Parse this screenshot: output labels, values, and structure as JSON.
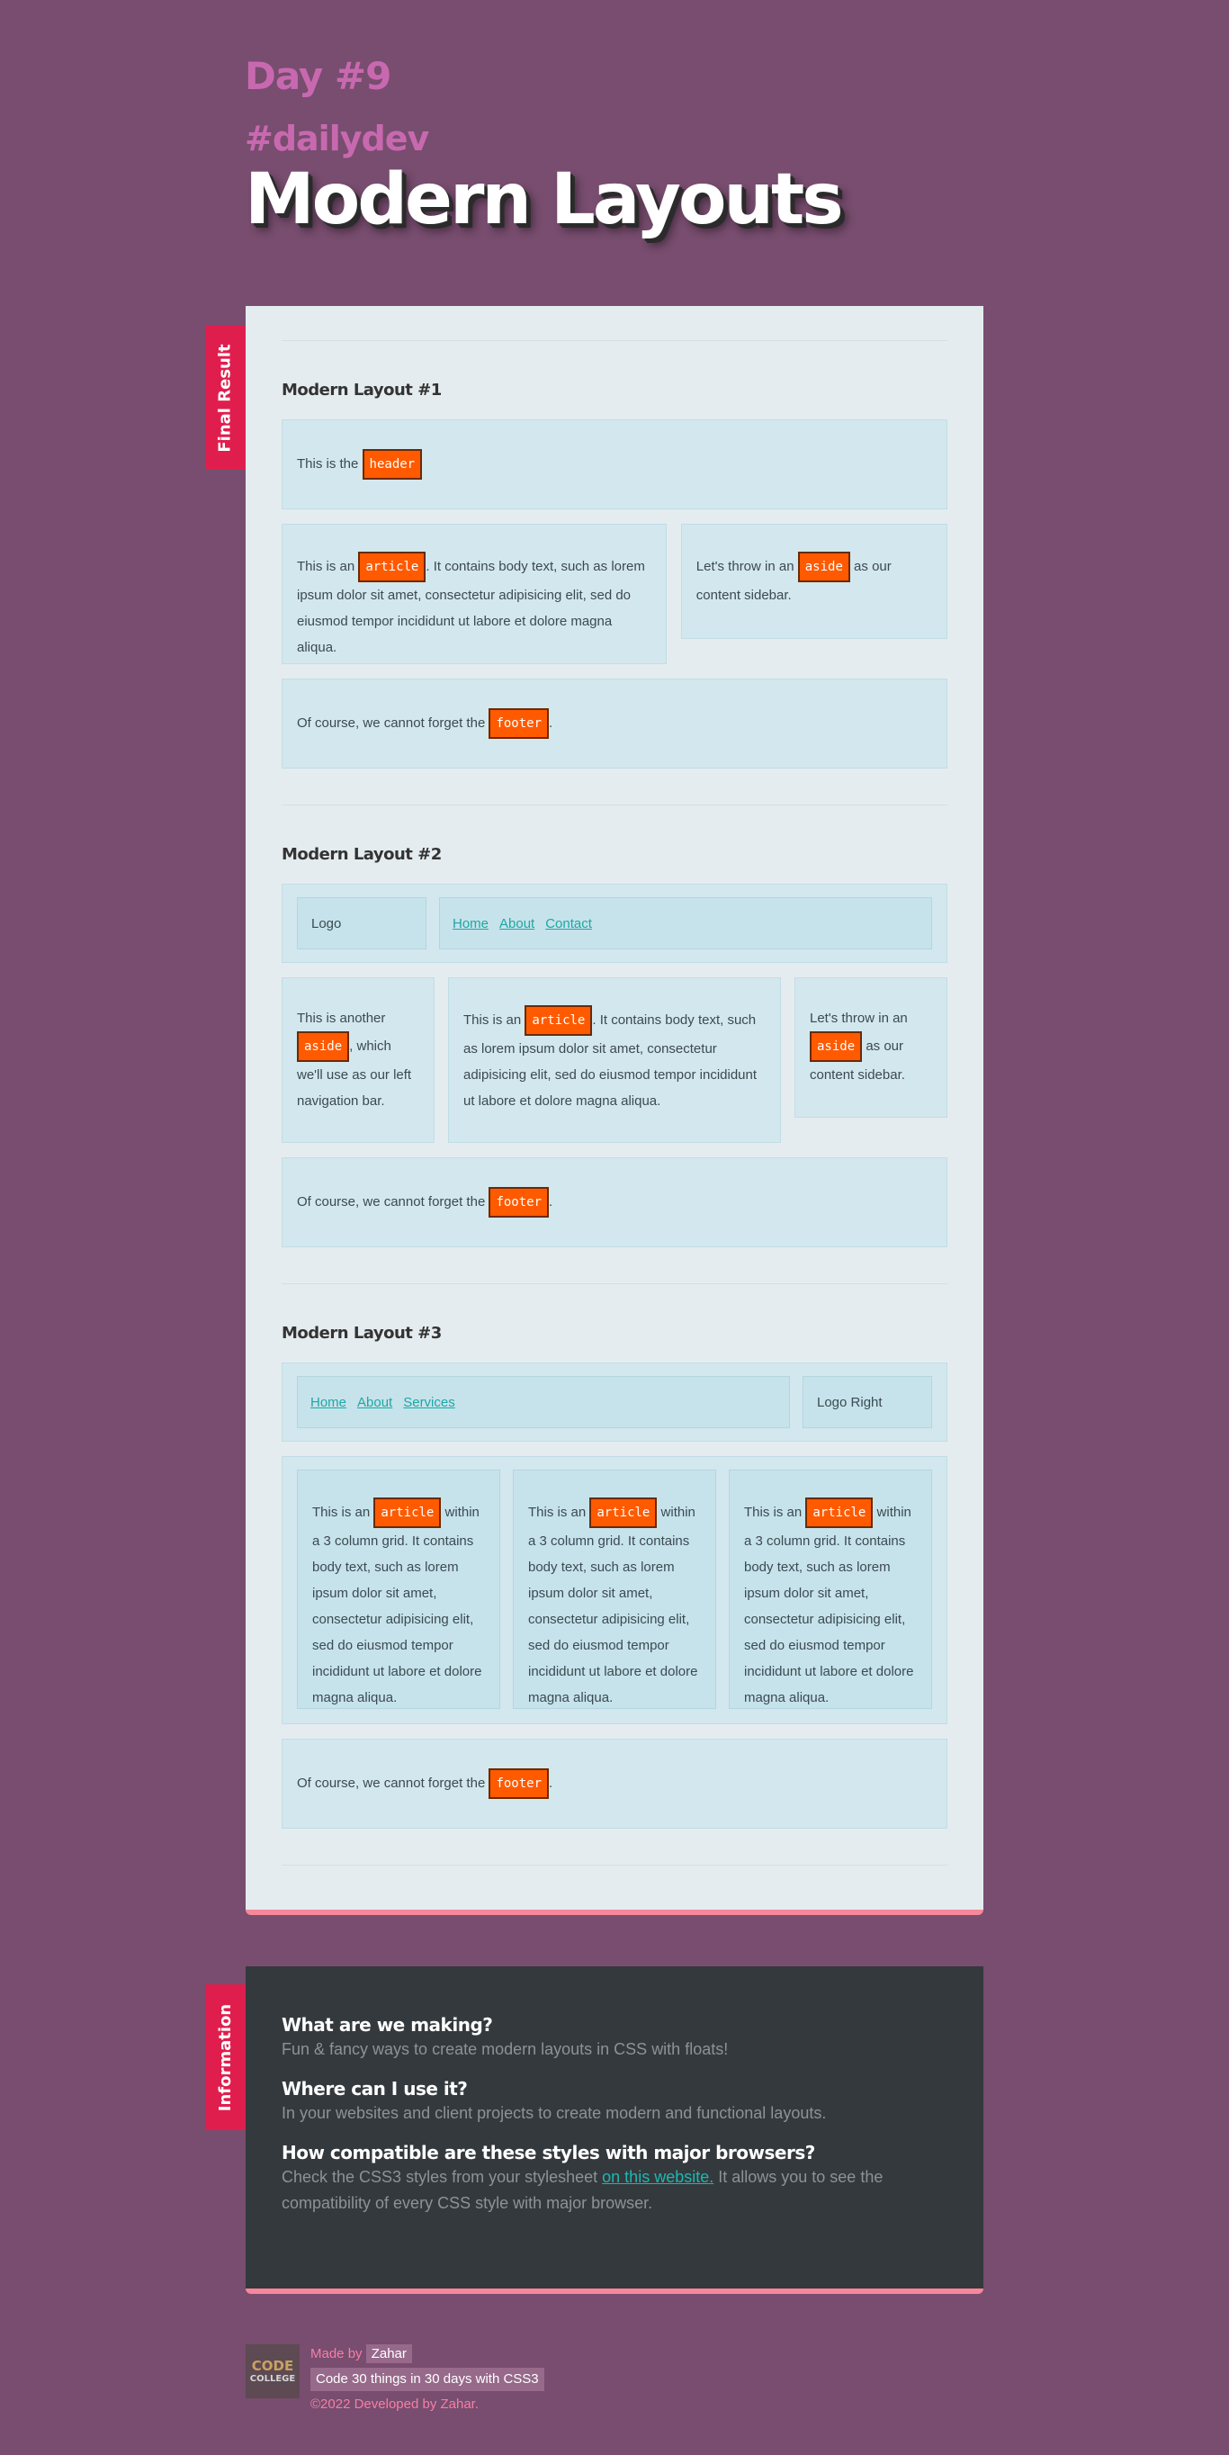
{
  "header": {
    "day": "Day #9",
    "tag": "#dailydev",
    "title": "Modern Layouts"
  },
  "colors": {
    "background": "#784d6f",
    "accent": "#e01e4d",
    "code_tag": "#ff5a00",
    "link": "#1fa7a2",
    "card_border": "#f7879a"
  },
  "main": {
    "ribbon": "Final Result",
    "layout1": {
      "title": "Modern Layout #1",
      "header_pre": "This is the ",
      "header_tag": "header",
      "article_pre": "This is an ",
      "article_tag": "article",
      "article_post": ". It contains body text, such as lorem ipsum dolor sit amet, consectetur adipisicing elit, sed do eiusmod tempor incididunt ut labore et dolore magna aliqua.",
      "aside_pre": "Let's throw in an ",
      "aside_tag": "aside",
      "aside_post": " as our content sidebar.",
      "footer_pre": "Of course, we cannot forget the ",
      "footer_tag": "footer",
      "footer_post": "."
    },
    "layout2": {
      "title": "Modern Layout #2",
      "logo": "Logo",
      "nav": [
        "Home",
        "About",
        "Contact"
      ],
      "left_pre": "This is another ",
      "left_tag": "aside",
      "left_post": ", which we'll use as our left navigation bar.",
      "article_pre": "This is an ",
      "article_tag": "article",
      "article_post": ". It contains body text, such as lorem ipsum dolor sit amet, consectetur adipisicing elit, sed do eiusmod tempor incididunt ut labore et dolore magna aliqua.",
      "right_pre": "Let's throw in an ",
      "right_tag": "aside",
      "right_post": " as our content sidebar.",
      "footer_pre": "Of course, we cannot forget the ",
      "footer_tag": "footer",
      "footer_post": "."
    },
    "layout3": {
      "title": "Modern Layout #3",
      "nav": [
        "Home",
        "About",
        "Services"
      ],
      "logo_right": "Logo Right",
      "col_pre": "This is an ",
      "col_tag": "article",
      "col_post": " within a 3 column grid. It contains body text, such as lorem ipsum dolor sit amet, consectetur adipisicing elit, sed do eiusmod tempor incididunt ut labore et dolore magna aliqua.",
      "footer_pre": "Of course, we cannot forget the ",
      "footer_tag": "footer",
      "footer_post": "."
    }
  },
  "info": {
    "ribbon": "Information",
    "q1": "What are we making?",
    "a1": "Fun & fancy ways to create modern layouts in CSS with floats!",
    "q2": "Where can I use it?",
    "a2": "In your websites and client projects to create modern and functional layouts.",
    "q3": "How compatible are these styles with major browsers?",
    "a3_pre": "Check the CSS3 styles from your stylesheet ",
    "a3_link": "on this website.",
    "a3_post": " It allows you to see the compatibility of every CSS style with major browser."
  },
  "footer": {
    "logo_line1": "CODE",
    "logo_line2": "COLLEGE",
    "made_by": "Made by ",
    "author": "Zahar",
    "project": "Code 30 things in 30 days with CSS3",
    "copyright": "©2022 Developed by Zahar."
  }
}
